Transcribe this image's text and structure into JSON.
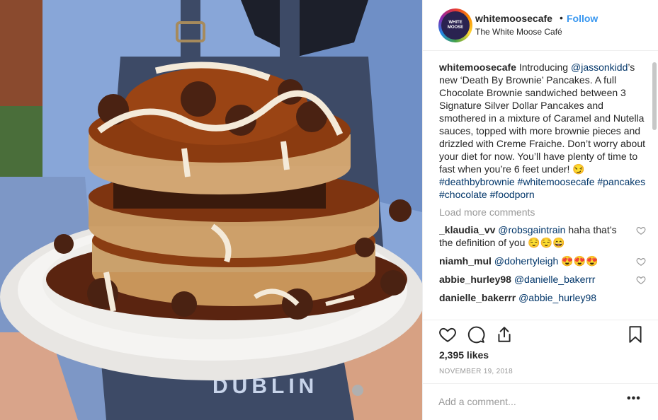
{
  "post": {
    "photo_apron_text": "DUBLIN",
    "avatar_text": "WHITE MOOSE"
  },
  "header": {
    "username": "whitemoosecafe",
    "separator": "•",
    "follow_label": "Follow",
    "location": "The White Moose Café"
  },
  "caption": {
    "username": "whitemoosecafe",
    "text_1": " Introducing ",
    "mention": "@jassonkidd",
    "text_2": "’s new ‘Death By Brownie’ Pancakes. A full Chocolate Brownie sandwiched between 3 Signature Silver Dollar Pancakes and smothered in a mixture of Caramel and Nutella sauces, topped with more brownie pieces and drizzled with Creme Fraiche. Don’t worry about your diet for now. You’ll have plenty of time to fast when you’re 6 feet under! 😏 ",
    "hashtags": [
      "#deathbybrownie",
      "#whitemoosecafe",
      "#pancakes",
      "#chocolate",
      "#foodporn"
    ]
  },
  "load_more_label": "Load more comments",
  "comments": [
    {
      "username": "_klaudia_vv",
      "mention": "@robsgaintrain",
      "text": " haha that’s the definition of you 😌😌😄"
    },
    {
      "username": "niamh_mul",
      "mention": "@dohertyleigh",
      "text": " 😍😍😍"
    },
    {
      "username": "abbie_hurley98",
      "mention": "@danielle_bakerrr",
      "text": ""
    },
    {
      "username": "danielle_bakerrr",
      "mention": "@abbie_hurley98",
      "text": ""
    }
  ],
  "likes": "2,395 likes",
  "date": "NOVEMBER 19, 2018",
  "comment_box": {
    "placeholder": "Add a comment..."
  },
  "more_options": "•••",
  "colors": {
    "accent": "#3897f0",
    "text": "#262626",
    "muted": "#999999",
    "link": "#003569",
    "border": "#efefef"
  },
  "icons": [
    "heart-icon",
    "comment-icon",
    "share-icon",
    "bookmark-icon",
    "small-heart-icon"
  ]
}
